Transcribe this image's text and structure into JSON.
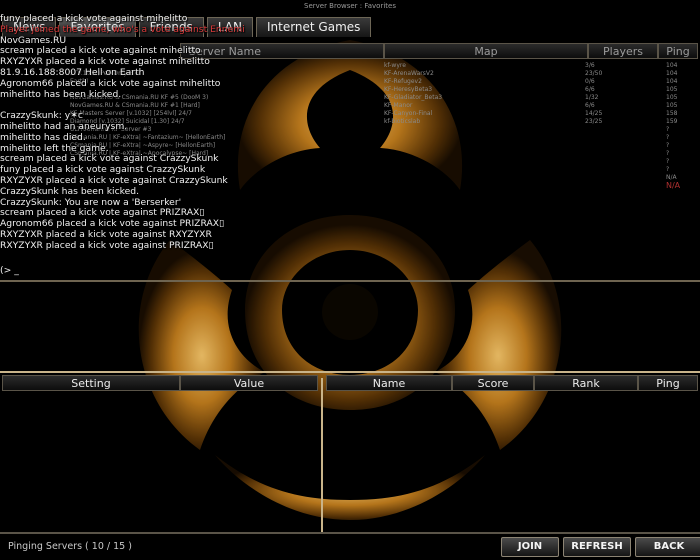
{
  "window": {
    "title": "Server Browser : Favorites"
  },
  "tabs": [
    {
      "label": "News"
    },
    {
      "label": "Favorites"
    },
    {
      "label": "Friends"
    },
    {
      "label": "LAN"
    },
    {
      "label": "Internet Games"
    }
  ],
  "server_list": {
    "columns": [
      "Server Name",
      "Map",
      "Players",
      "Ping"
    ],
    "rows": [
      {
        "name": "",
        "map": "kf-wyre",
        "players": "3/6",
        "ping": "104"
      },
      {
        "name": "2TV.1032)PerkOnly-6lvl",
        "map": "KF-ArenaWarsV2",
        "players": "23/50",
        "ping": "104"
      },
      {
        "name": "Earth)",
        "map": "KF-Refugev2",
        "players": "0/6",
        "ping": "104"
      },
      {
        "name": "",
        "map": "KF-HeresyBeta3",
        "players": "6/6",
        "ping": "105"
      },
      {
        "name": "NovGames.RU & CSmania.RU KF #5 (DooM 3)",
        "map": "KF-Gladiator_Beta3",
        "players": "1/32",
        "ping": "105"
      },
      {
        "name": "NovGames.RU & CSmania.RU KF #1 [Hard]",
        "map": "KF-Manor",
        "players": "6/6",
        "ping": "105"
      },
      {
        "name": "KF-Masters Server [v.1032] [254lvl] 24/7",
        "map": "KF-Canyon-Final",
        "players": "14/25",
        "ping": "158"
      },
      {
        "name": "Diamond [v.1032] Suicidal [1.30] 24/7",
        "map": "kf-bioticslab",
        "players": "23/25",
        "ping": "159"
      },
      {
        "name": "ULTRAmarine KF Server #3",
        "map": "",
        "players": "",
        "ping": "?"
      },
      {
        "name": "CSmania.RU | KF-eXtra| ~Fantazium~ [HellonEarth]",
        "map": "",
        "players": "",
        "ping": "?"
      },
      {
        "name": "CSmania.RU | KF-eXtra| ~Aspyre~ [HellonEarth]",
        "map": "",
        "players": "",
        "ping": "?"
      },
      {
        "name": "CSmania.RU | KF-eXtra| ~Apocalypse~ [Hard]",
        "map": "",
        "players": "",
        "ping": "?"
      },
      {
        "name": "",
        "map": "",
        "players": "",
        "ping": "?"
      },
      {
        "name": "",
        "map": "",
        "players": "",
        "ping": "?"
      },
      {
        "name": "",
        "map": "",
        "players": "",
        "ping": "N/A"
      },
      {
        "name": "",
        "map": "",
        "players": "",
        "ping": "N/A"
      }
    ]
  },
  "console": {
    "lines": [
      {
        "text": "funy placed a kick vote against mihelitto",
        "color": ""
      },
      {
        "text": "Player joined the game, who's a vote against Ennemi",
        "color": "red"
      },
      {
        "text": "NovGames.RU",
        "color": ""
      },
      {
        "text": "scream placed a kick vote against mihelitto",
        "color": ""
      },
      {
        "text": "RXYZYXR placed a kick vote against mihelitto",
        "color": ""
      },
      {
        "text": "81.9.16.188:8007 Hell on Earth",
        "color": ""
      },
      {
        "text": "Agronom66 placed a kick vote against mihelitto",
        "color": ""
      },
      {
        "text": "mihelitto has been kicked.",
        "color": ""
      },
      {
        "text": "",
        "color": ""
      },
      {
        "text": "CrazzySkunk: y✶c",
        "color": ""
      },
      {
        "text": "mihelitto had an aneurysm.",
        "color": ""
      },
      {
        "text": "mihelitto has died.",
        "color": ""
      },
      {
        "text": "mihelitto left the game.",
        "color": ""
      },
      {
        "text": "scream placed a kick vote against CrazzySkunk",
        "color": ""
      },
      {
        "text": "funy placed a kick vote against CrazzySkunk",
        "color": ""
      },
      {
        "text": "RXYZYXR placed a kick vote against CrazzySkunk",
        "color": ""
      },
      {
        "text": "CrazzySkunk has been kicked.",
        "color": ""
      },
      {
        "text": "CrazzySkunk: You are now a 'Berserker'",
        "color": ""
      },
      {
        "text": "scream placed a kick vote against PRIZRAX▯",
        "color": ""
      },
      {
        "text": "Agronom66 placed a kick vote against PRIZRAX▯",
        "color": ""
      },
      {
        "text": "RXYZYXR placed a kick vote against RXYZYXR",
        "color": ""
      },
      {
        "text": "RXYZYXR placed a kick vote against PRIZRAX▯",
        "color": ""
      }
    ],
    "input_prompt": "(> _"
  },
  "rules_table": {
    "columns": [
      "Setting",
      "Value"
    ]
  },
  "players_table": {
    "columns": [
      "Name",
      "Score",
      "Rank",
      "Ping"
    ]
  },
  "status": {
    "text": "Pinging Servers ( 10 / 15 )"
  },
  "buttons": {
    "join": "JOIN",
    "refresh": "REFRESH",
    "back": "BACK"
  },
  "colors": {
    "accent_gold": "#c9b48a",
    "console_red": "#d83a3a",
    "ping_na_red": "#b03030",
    "hazard_orange": "#d08a20"
  },
  "icons": {
    "background": "biohazard-icon"
  }
}
